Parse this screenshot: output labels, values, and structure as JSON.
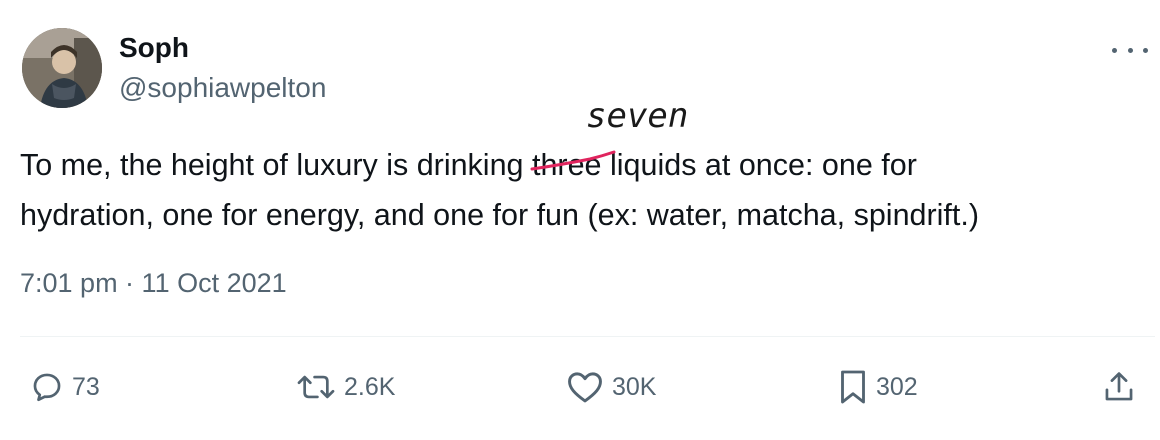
{
  "author": {
    "display_name": "Soph",
    "handle": "@sophiawpelton"
  },
  "tweet": {
    "line1_before": "To me, the height of luxury is drinking ",
    "struck_word": "three",
    "line1_after": " liquids at once: one for",
    "line2": "hydration, one for energy, and one for fun (ex: water, matcha, spindrift.)",
    "handwritten_correction": "seven",
    "timestamp": "7:01 pm · 11 Oct 2021"
  },
  "actions": {
    "replies": "73",
    "reposts": "2.6K",
    "likes": "30K",
    "bookmarks": "302"
  },
  "icons": {
    "more": "more-options-icon",
    "reply": "reply-icon",
    "repost": "repost-icon",
    "like": "heart-icon",
    "bookmark": "bookmark-icon",
    "share": "share-icon"
  },
  "colors": {
    "text": "#0f1419",
    "secondary": "#536471",
    "strike": "#e0245e",
    "divider": "#eff3f4"
  }
}
